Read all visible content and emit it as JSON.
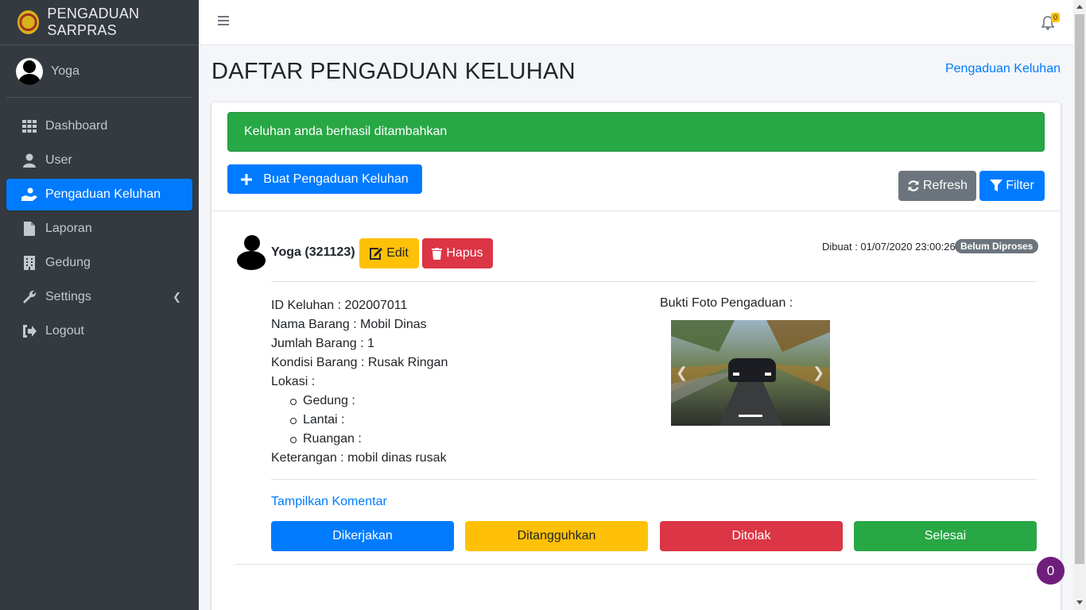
{
  "brand": {
    "title": "PENGADUAN SARPRAS"
  },
  "user": {
    "name": "Yoga"
  },
  "sidebar": {
    "items": [
      {
        "label": "Dashboard",
        "icon": "grid-icon",
        "active": false
      },
      {
        "label": "User",
        "icon": "user-icon",
        "active": false
      },
      {
        "label": "Pengaduan Keluhan",
        "icon": "hand-user-icon",
        "active": true
      },
      {
        "label": "Laporan",
        "icon": "document-icon",
        "active": false
      },
      {
        "label": "Gedung",
        "icon": "building-icon",
        "active": false
      },
      {
        "label": "Settings",
        "icon": "wrench-icon",
        "active": false
      },
      {
        "label": "Logout",
        "icon": "logout-icon",
        "active": false
      }
    ]
  },
  "header": {
    "notification_count": "0"
  },
  "page": {
    "title": "DAFTAR PENGADUAN KELUHAN",
    "breadcrumb": "Pengaduan Keluhan"
  },
  "alert": {
    "message": "Keluhan anda berhasil ditambahkan",
    "color": "#28a745"
  },
  "toolbar": {
    "create_label": "Buat Pengaduan Keluhan",
    "refresh_label": "Refresh",
    "filter_label": "Filter"
  },
  "complaint": {
    "user": "Yoga (321123)",
    "edit_label": "Edit",
    "delete_label": "Hapus",
    "created": "Dibuat : 01/07/2020 23:00:26",
    "status": "Belum Diproses",
    "id_line": "ID Keluhan : 202007011",
    "item_name_line": "Nama Barang : Mobil Dinas",
    "quantity_line": "Jumlah Barang : 1",
    "condition_line": "Kondisi Barang : Rusak Ringan",
    "location_label": "Lokasi :",
    "building_line": "Gedung :",
    "floor_line": "Lantai :",
    "room_line": "Ruangan :",
    "note_line": "Keterangan : mobil dinas rusak",
    "photo_label": "Bukti Foto Pengaduan :",
    "show_comments": "Tampilkan Komentar",
    "actions": {
      "working": "Dikerjakan",
      "postponed": "Ditangguhkan",
      "rejected": "Ditolak",
      "done": "Selesai"
    }
  },
  "floating": {
    "count": "0"
  }
}
